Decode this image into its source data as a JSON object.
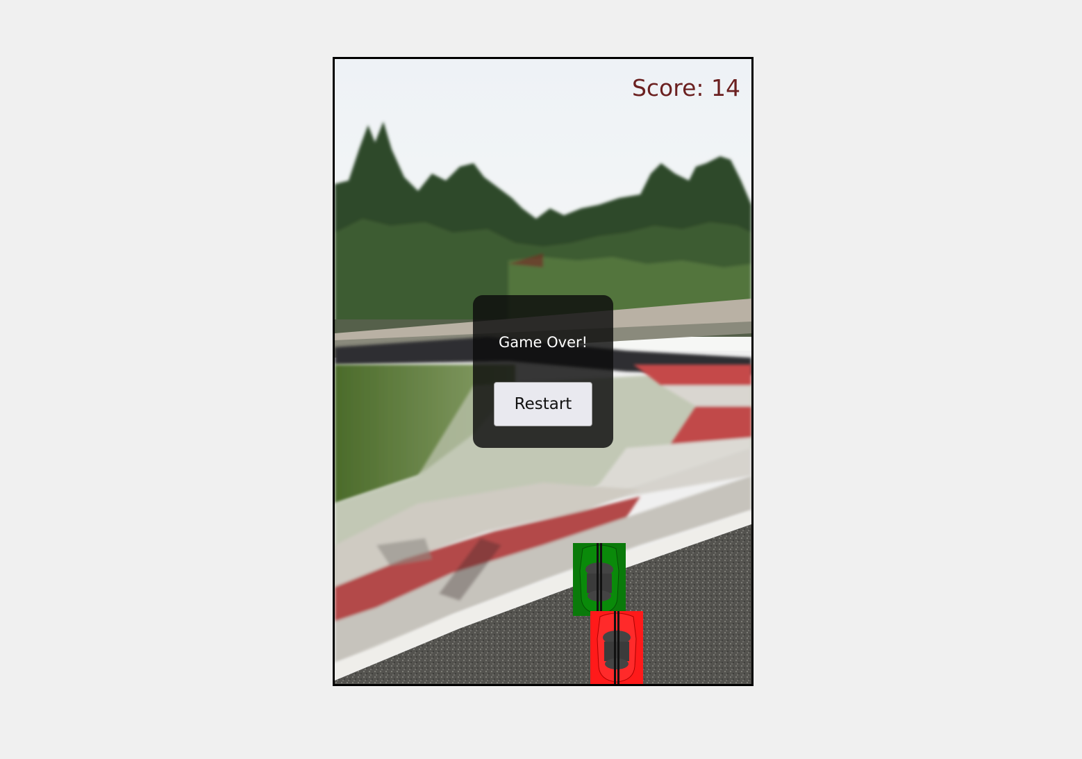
{
  "hud": {
    "score_text": "Score: 14"
  },
  "dialog": {
    "message": "Game Over!",
    "restart_label": "Restart"
  },
  "colors": {
    "page_bg": "#f0f0f0",
    "score": "#6b2020",
    "player_car": "#ff1a1a",
    "obstacle_car": "#0a7a0a"
  },
  "icons": {
    "player": "red-race-car-icon",
    "obstacle": "green-race-car-icon"
  }
}
